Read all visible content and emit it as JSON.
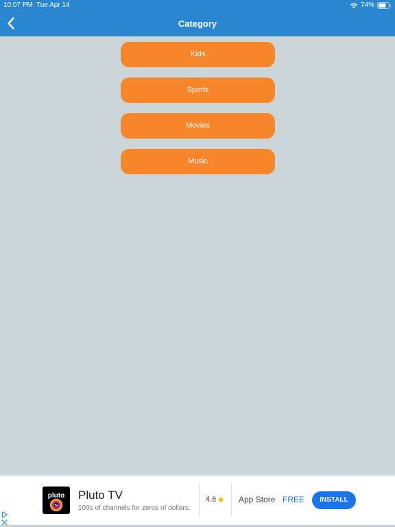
{
  "status_bar": {
    "time": "10:07 PM",
    "date": "Tue Apr 14",
    "battery": "74%"
  },
  "nav": {
    "title": "Category",
    "back_icon": "chevron-left-icon"
  },
  "categories": [
    "Kids",
    "Sports",
    "Movies",
    "Music"
  ],
  "ad": {
    "app_name": "Pluto TV",
    "tagline": "100s of channels for zeros of dollars.",
    "rating": "4.6",
    "store": "App Store",
    "price": "FREE",
    "install_label": "INSTALL",
    "logo_text_top": "pluto",
    "logo_text_bottom": "tv"
  },
  "colors": {
    "header": "#2a86cf",
    "background": "#ccd5d8",
    "category_button": "#f7862a",
    "install_button": "#1a73e8"
  }
}
